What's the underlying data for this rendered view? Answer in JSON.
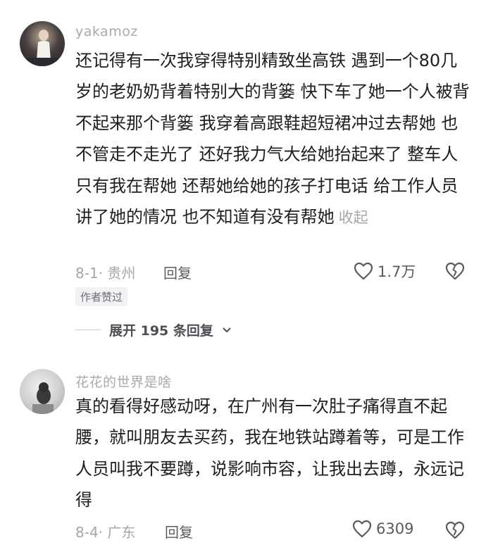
{
  "comments": [
    {
      "username": "yakamoz",
      "text": "还记得有一次我穿得特别精致坐高铁 遇到一个80几岁的老奶奶背着特别大的背篓 快下车了她一个人被背不起来那个背篓 我穿着高跟鞋超短裙冲过去帮她 也不管走不走光了 还好我力气大给她抬起来了 整车人只有我在帮她 还帮她给她的孩子打电话 给工作人员讲了她的情况 也不知道有没有帮她",
      "collapse_label": "收起",
      "date_location": "8-1· 贵州",
      "reply_label": "回复",
      "likes": "1.7万",
      "badge": "作者赞过",
      "expand_label": "展开 195 条回复",
      "avatar_icon": "user-avatar-photo"
    },
    {
      "username": "花花的世界是啥",
      "text": "真的看得好感动呀，在广州有一次肚子痛得直不起腰，就叫朋友去买药，我在地铁站蹲着等，可是工作人员叫我不要蹲，说影响市容，让我出去蹲，永远记得",
      "date_location": "8-4· 广东",
      "reply_label": "回复",
      "likes": "6309",
      "avatar_icon": "user-avatar-photo"
    }
  ],
  "icons": {
    "like": "heart-outline-icon",
    "dislike": "broken-heart-icon",
    "expand": "chevron-down-icon"
  },
  "colors": {
    "text_primary": "#1e1e1e",
    "text_secondary": "#a6a6ab",
    "icon": "#5a5a60"
  }
}
